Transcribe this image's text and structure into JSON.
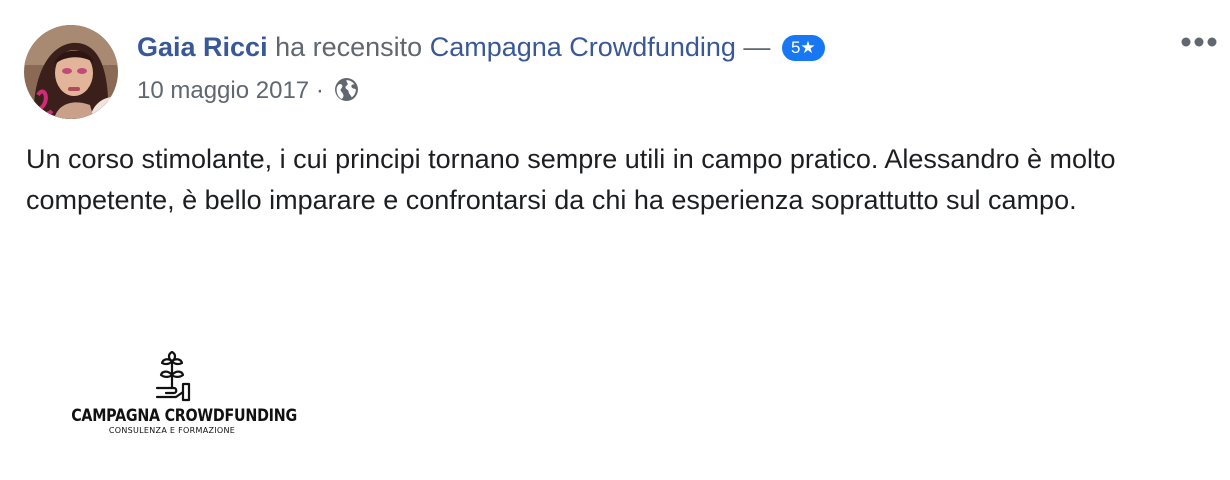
{
  "review": {
    "author_name": "Gaia Ricci",
    "action_text": "ha recensito",
    "page_name": "Campagna Crowdfunding",
    "separator": "—",
    "rating_label": "5★",
    "rating_value": 5,
    "date": "10 maggio 2017",
    "meta_separator": "·",
    "privacy_icon": "globe-icon",
    "more_icon": "more-options-icon",
    "text": "Un corso stimolante, i cui principi tornano sempre utili in campo pratico. Alessandro è molto competente, è bello imparare e confrontarsi da chi ha esperienza soprattutto sul campo."
  },
  "page_logo": {
    "title": "CAMPAGNA CROWDFUNDING",
    "subtitle": "CONSULENZA E FORMAZIONE",
    "icon": "hand-holding-plant-icon"
  },
  "colors": {
    "link": "#385898",
    "secondary_text": "#606770",
    "primary_text": "#1c1e21",
    "badge": "#1877f2",
    "icon": "#606770"
  }
}
